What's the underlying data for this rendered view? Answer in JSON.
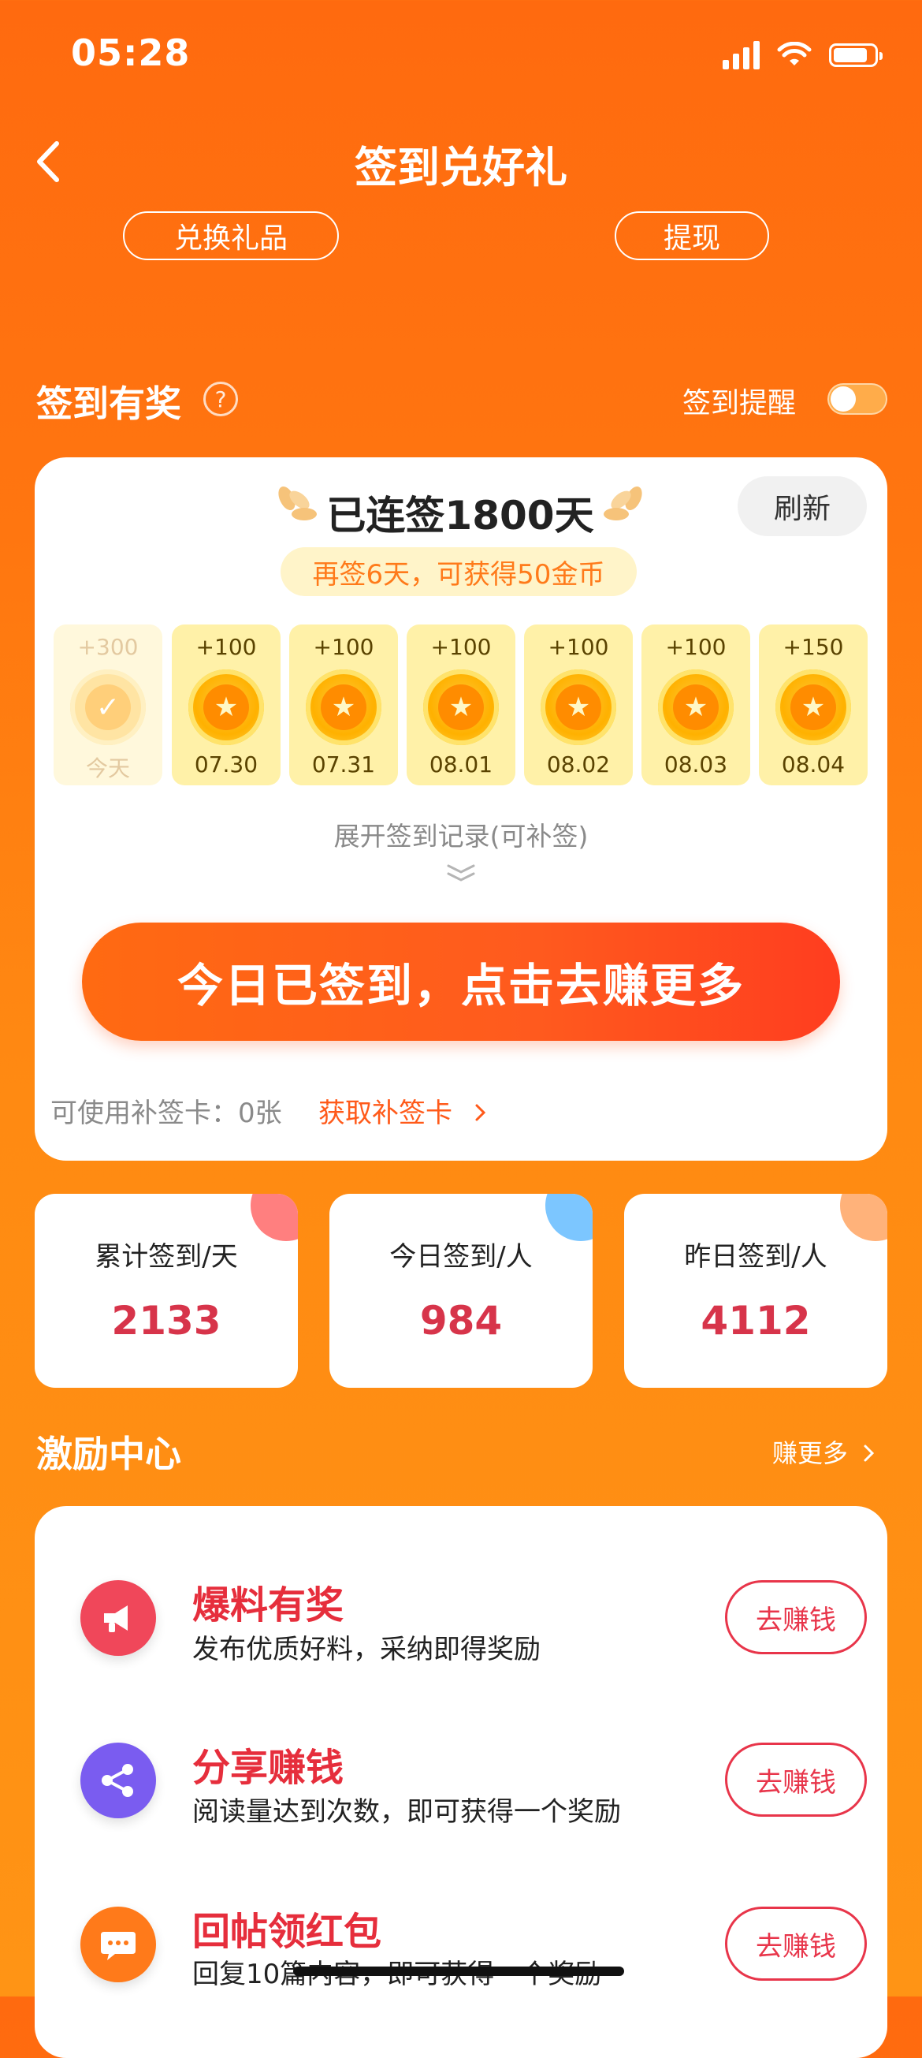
{
  "status_bar": {
    "time": "05:28"
  },
  "header": {
    "title": "签到兑好礼"
  },
  "top_actions": {
    "exchange": "兑换礼品",
    "withdraw": "提现"
  },
  "sign_section": {
    "title": "签到有奖",
    "help": "?",
    "reminder_label": "签到提醒",
    "reminder_on": false
  },
  "sign_card": {
    "streak": "已连签1800天",
    "refresh": "刷新",
    "bonus_tip": "再签6天，可获得50金币",
    "days": [
      {
        "points": "+300",
        "date": "今天",
        "checked": true
      },
      {
        "points": "+100",
        "date": "07.30",
        "checked": false
      },
      {
        "points": "+100",
        "date": "07.31",
        "checked": false
      },
      {
        "points": "+100",
        "date": "08.01",
        "checked": false
      },
      {
        "points": "+100",
        "date": "08.02",
        "checked": false
      },
      {
        "points": "+100",
        "date": "08.03",
        "checked": false
      },
      {
        "points": "+150",
        "date": "08.04",
        "checked": false
      }
    ],
    "expand": "展开签到记录(可补签)",
    "cta": "今日已签到，点击去赚更多",
    "makeup_text": "可使用补签卡：0张",
    "makeup_link": "获取补签卡"
  },
  "stats": [
    {
      "label": "累计签到/天",
      "value": "2133",
      "accent": "#ff7f7f"
    },
    {
      "label": "今日签到/人",
      "value": "984",
      "accent": "#7cc6ff"
    },
    {
      "label": "昨日签到/人",
      "value": "4112",
      "accent": "#ffb27a"
    }
  ],
  "incentive": {
    "title": "激励中心",
    "more": "赚更多",
    "tasks": [
      {
        "icon": "megaphone-icon",
        "title": "爆料有奖",
        "desc": "发布优质好料，采纳即得奖励",
        "button": "去赚钱",
        "color": "#f0475a"
      },
      {
        "icon": "share-icon",
        "title": "分享赚钱",
        "desc": "阅读量达到次数，即可获得一个奖励",
        "button": "去赚钱",
        "color": "#7a5cf0"
      },
      {
        "icon": "chat-icon",
        "title": "回帖领红包",
        "desc": "回复10篇内容，即可获得一个奖励",
        "button": "去赚钱",
        "color": "#ff7a1a"
      }
    ]
  }
}
